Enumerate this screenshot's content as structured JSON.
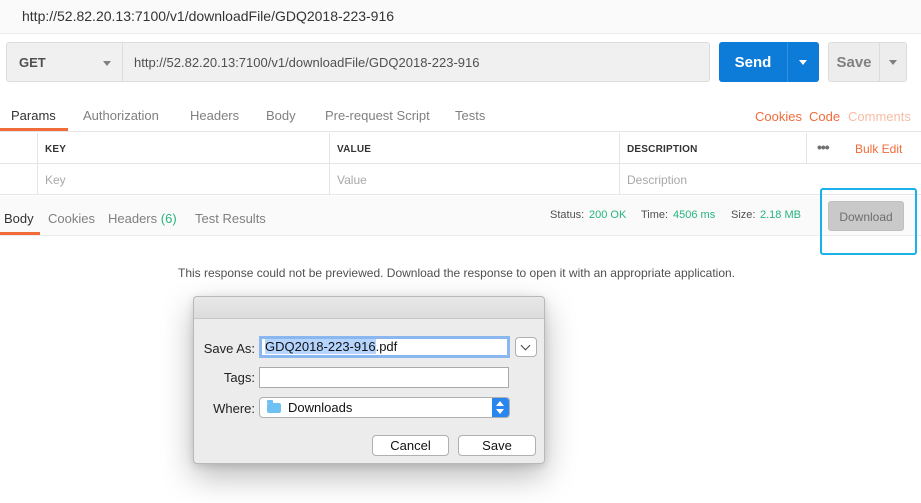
{
  "window": {
    "title": "http://52.82.20.13:7100/v1/downloadFile/GDQ2018-223-916"
  },
  "request": {
    "method": "GET",
    "url": "http://52.82.20.13:7100/v1/downloadFile/GDQ2018-223-916",
    "send_label": "Send",
    "save_label": "Save"
  },
  "request_tabs": {
    "items": [
      "Params",
      "Authorization",
      "Headers",
      "Body",
      "Pre-request Script",
      "Tests"
    ],
    "active": "Params",
    "right_links": {
      "cookies": "Cookies",
      "code": "Code",
      "comments": "Comments"
    }
  },
  "params_table": {
    "headers": {
      "key": "KEY",
      "value": "VALUE",
      "description": "DESCRIPTION"
    },
    "placeholders": {
      "key": "Key",
      "value": "Value",
      "description": "Description"
    },
    "more": "•••",
    "bulk_edit": "Bulk Edit"
  },
  "response": {
    "tabs": {
      "body": "Body",
      "cookies": "Cookies",
      "headers": "Headers",
      "headers_count": "(6)",
      "test_results": "Test Results"
    },
    "active": "Body",
    "status_label": "Status:",
    "status_value": "200 OK",
    "time_label": "Time:",
    "time_value": "4506 ms",
    "size_label": "Size:",
    "size_value": "2.18 MB",
    "download_label": "Download",
    "message": "This response could not be previewed. Download the response to open it with an appropriate application."
  },
  "save_dialog": {
    "save_as_label": "Save As:",
    "filename_selected": "GDQ2018-223-916",
    "filename_ext": ".pdf",
    "tags_label": "Tags:",
    "tags_value": "",
    "where_label": "Where:",
    "where_value": "Downloads",
    "cancel_label": "Cancel",
    "save_label": "Save"
  },
  "colors": {
    "accent_orange": "#f26b3a",
    "send_blue": "#0d7bd8",
    "status_green": "#26b47f",
    "highlight_cyan": "#1ab0ea"
  }
}
